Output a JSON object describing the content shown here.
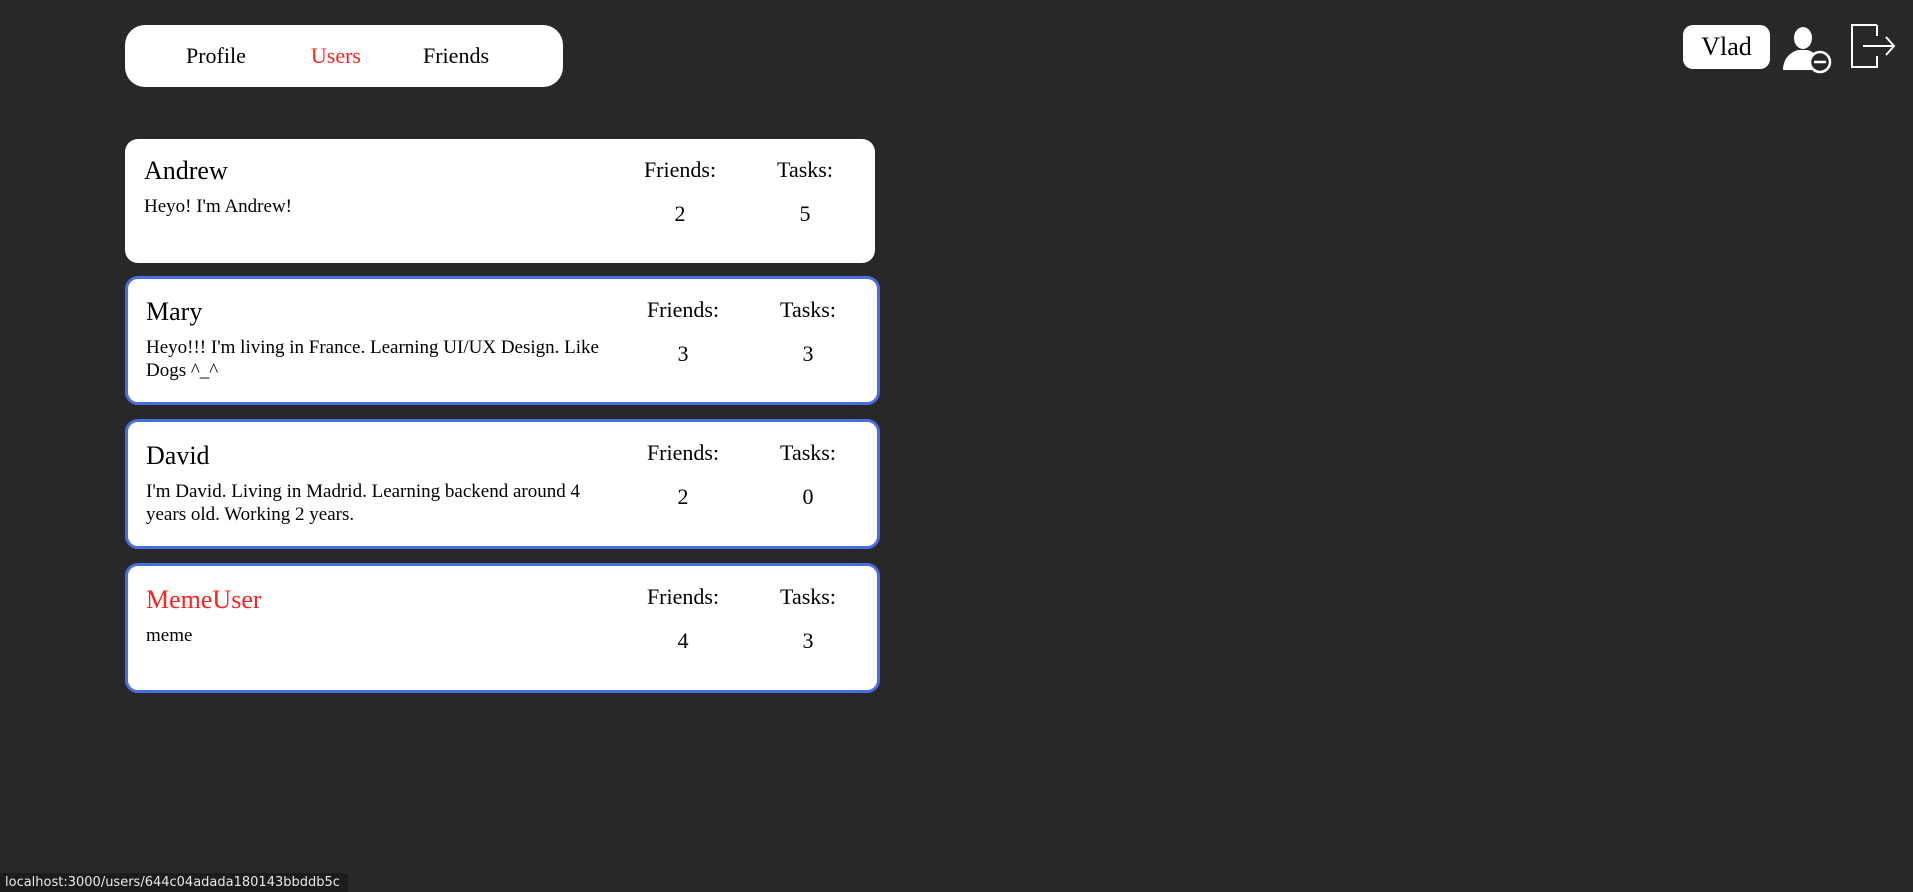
{
  "nav": {
    "items": [
      {
        "label": "Profile",
        "active": false
      },
      {
        "label": "Users",
        "active": true
      },
      {
        "label": "Friends",
        "active": false
      }
    ]
  },
  "header": {
    "username": "Vlad",
    "remove_user_icon": "user-remove-icon",
    "logout_icon": "logout-icon"
  },
  "stats_labels": {
    "friends": "Friends:",
    "tasks": "Tasks:"
  },
  "users": [
    {
      "name": "Andrew",
      "bio": "Heyo! I'm Andrew!",
      "friends": "2",
      "tasks": "5",
      "outlined": false,
      "is_self": false
    },
    {
      "name": "Mary",
      "bio": "Heyo!!! I'm living in France. Learning UI/UX Design. Like Dogs ^_^",
      "friends": "3",
      "tasks": "3",
      "outlined": true,
      "is_self": false
    },
    {
      "name": "David",
      "bio": "I'm David. Living in Madrid. Learning backend around 4 years old. Working 2 years.",
      "friends": "2",
      "tasks": "0",
      "outlined": true,
      "is_self": false
    },
    {
      "name": "MemeUser",
      "bio": "meme",
      "friends": "4",
      "tasks": "3",
      "outlined": true,
      "is_self": true
    }
  ],
  "status_bar": {
    "url": "localhost:3000/users/644c04adada180143bbddb5c"
  },
  "colors": {
    "background": "#282828",
    "accent_red": "#ff2020",
    "card_outline": "#4a6ee0"
  }
}
